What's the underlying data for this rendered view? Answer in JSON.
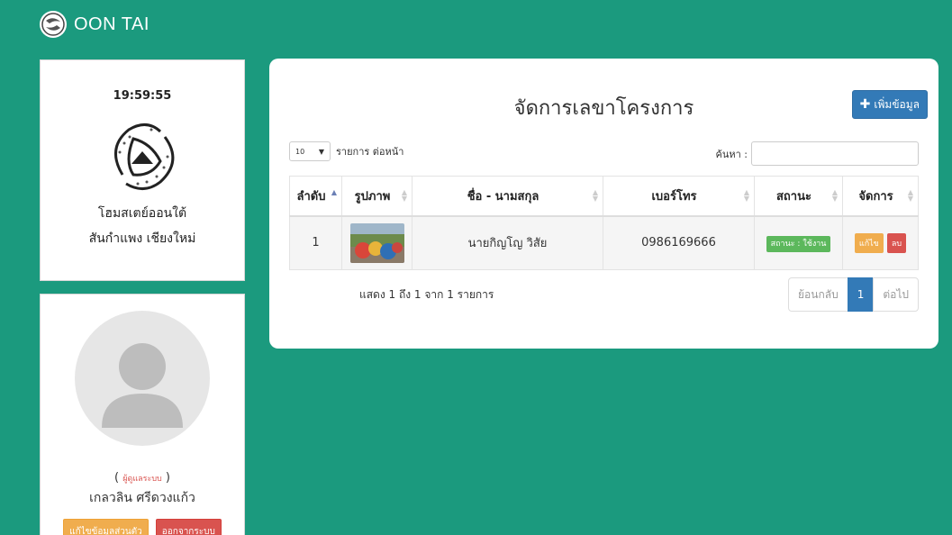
{
  "header": {
    "brand": "OON TAI"
  },
  "sidebar": {
    "clock": "19:59:55",
    "shop_name": "โฮมสเตย์ออนใต้",
    "shop_address": "สันกำแพง เชียงใหม่",
    "user_role": "ผู้ดูแลระบบ",
    "user_name": "เกลวลิน ศรีดวงแก้ว",
    "edit_profile_label": "แก้ไขข้อมูลส่วนตัว",
    "logout_label": "ออกจากระบบ"
  },
  "main": {
    "title": "จัดการเลขาโครงการ",
    "add_label": "เพิ่มข้อมูล",
    "page_length": "10",
    "page_length_label": "รายการ ต่อหน้า",
    "search_label": "ค้นหา :",
    "columns": [
      "ลำดับ",
      "รูปภาพ",
      "ชื่อ - นามสกุล",
      "เบอร์โทร",
      "สถานะ",
      "จัดการ"
    ],
    "rows": [
      {
        "no": "1",
        "name": "นายกิญโญ วิสัย",
        "phone": "0986169666",
        "status": "สถานะ : ใช้งาน",
        "edit": "แก้ไข",
        "delete": "ลบ"
      }
    ],
    "info": "แสดง 1 ถึง 1 จาก 1 รายการ",
    "pager": {
      "prev": "ย้อนกลับ",
      "current": "1",
      "next": "ต่อไป"
    }
  },
  "colors": {
    "background": "#1b9a7e",
    "primary": "#337ab7",
    "success": "#5cb85c",
    "warning": "#f0ad4e",
    "danger": "#d9534f"
  }
}
